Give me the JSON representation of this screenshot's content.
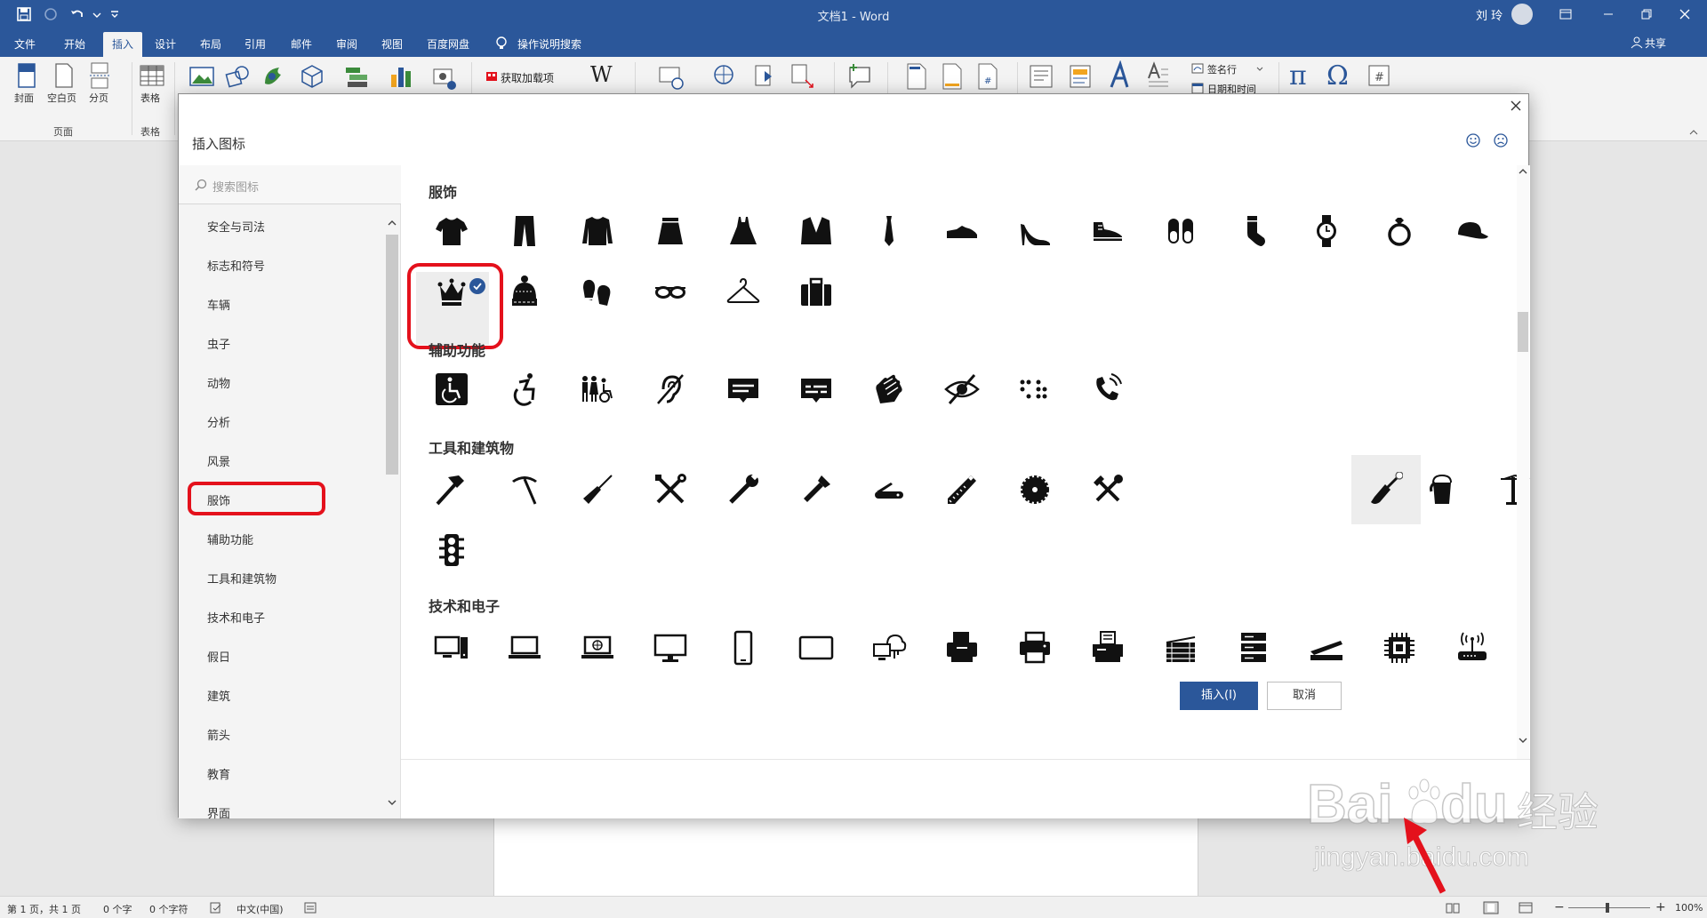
{
  "app": {
    "doc_title": "文档1",
    "app_name": "Word",
    "sep": " - ",
    "user": "刘 玲"
  },
  "tabs": [
    "文件",
    "开始",
    "插入",
    "设计",
    "布局",
    "引用",
    "邮件",
    "审阅",
    "视图",
    "百度网盘"
  ],
  "tell_me": "操作说明搜索",
  "share": "共享",
  "ribbon": {
    "cover": "封面",
    "blank": "空白页",
    "break": "分页",
    "table": "表格",
    "group_pages": "页面",
    "group_table": "表格",
    "addins": "获取加载项",
    "signature": "签名行",
    "datetime": "日期和时间"
  },
  "dialog": {
    "title": "插入图标",
    "search_placeholder": "搜索图标",
    "categories": [
      "安全与司法",
      "标志和符号",
      "车辆",
      "虫子",
      "动物",
      "分析",
      "风景",
      "服饰",
      "辅助功能",
      "工具和建筑物",
      "技术和电子",
      "假日",
      "建筑",
      "箭头",
      "教育",
      "界面"
    ],
    "sections": [
      "服饰",
      "辅助功能",
      "工具和建筑物",
      "技术和电子"
    ],
    "insert_label": "插入(I)",
    "cancel_label": "取消"
  },
  "status": {
    "page": "第 1 页，共 1 页",
    "words": "0 个字",
    "chars": "0 个字符",
    "lang": "中文(中国)",
    "zoom": "100%"
  },
  "watermark": {
    "brand": "Bai",
    "brand2": "du",
    "jy": "经验",
    "url": "jingyan.baidu.com"
  },
  "colors": {
    "word_blue": "#2b579a",
    "highlight_red": "#e4111c"
  }
}
